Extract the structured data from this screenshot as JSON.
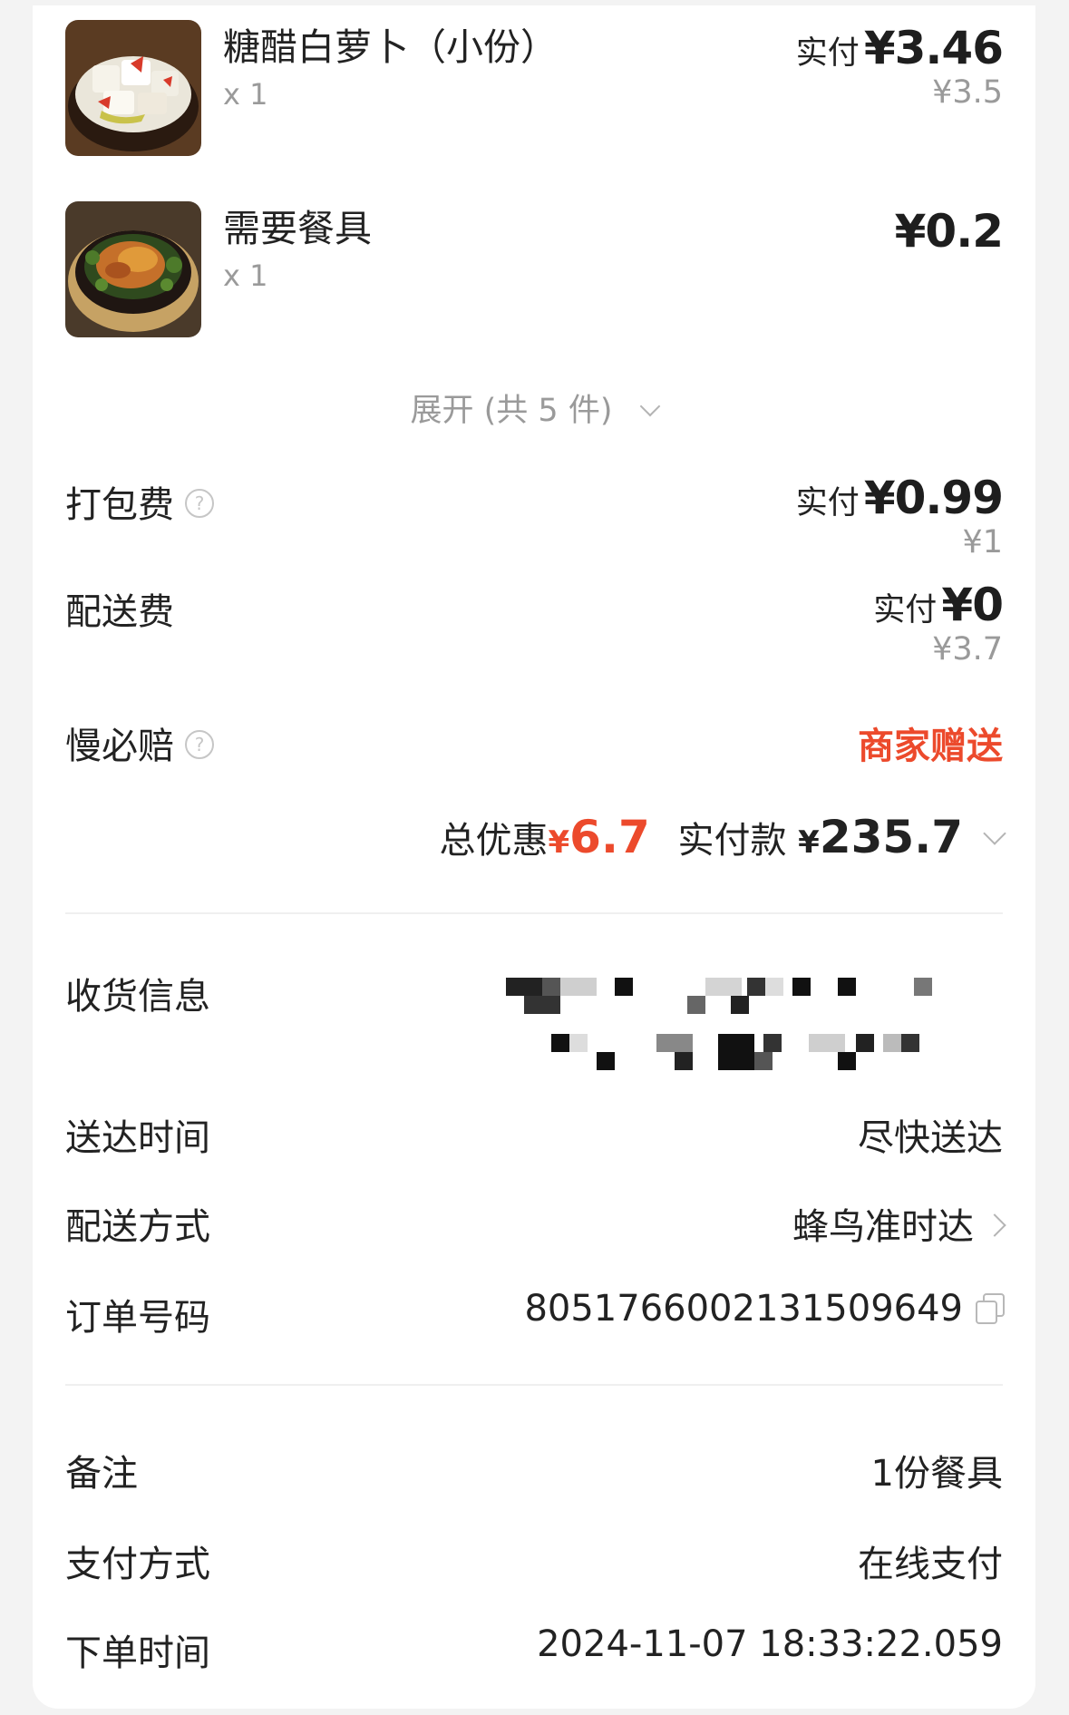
{
  "items": [
    {
      "name": "糖醋白萝卜（小份）",
      "qty": "x 1",
      "paid_label": "实付",
      "paid_value": "¥3.46",
      "original": "¥3.5",
      "image": "pickled-radish-image"
    },
    {
      "name": "需要餐具",
      "qty": "x 1",
      "paid_value": "¥0.2",
      "image": "braised-chicken-image"
    }
  ],
  "expand": {
    "label": "展开 (共 5 件)",
    "icon": "chevron-down-icon"
  },
  "fees": {
    "packing": {
      "label": "打包费",
      "paid_label": "实付",
      "paid_value": "¥0.99",
      "original": "¥1",
      "icon": "question-icon"
    },
    "delivery": {
      "label": "配送费",
      "paid_label": "实付",
      "paid_value": "¥0",
      "original": "¥3.7"
    },
    "late_compensation": {
      "label": "慢必赔",
      "value": "商家赠送",
      "icon": "question-icon"
    }
  },
  "totals": {
    "discount_label": "总优惠",
    "discount_yen": "¥",
    "discount_value": "6.7",
    "paid_label": "实付款",
    "paid_yen": "¥",
    "paid_value": "235.7"
  },
  "info": {
    "receiver_label": "收货信息",
    "arrival_label": "送达时间",
    "arrival_value": "尽快送达",
    "delivery_method_label": "配送方式",
    "delivery_method_value": "蜂鸟准时达",
    "order_no_label": "订单号码",
    "order_no_value": "8051766002131509649"
  },
  "extra": {
    "note_label": "备注",
    "note_value": "1份餐具",
    "payment_label": "支付方式",
    "payment_value": "在线支付",
    "order_time_label": "下单时间",
    "order_time_value": "2024-11-07 18:33:22.059"
  },
  "colors": {
    "accent_red": "#ec4a2c",
    "text": "#222222",
    "muted": "#9a9a9a"
  }
}
